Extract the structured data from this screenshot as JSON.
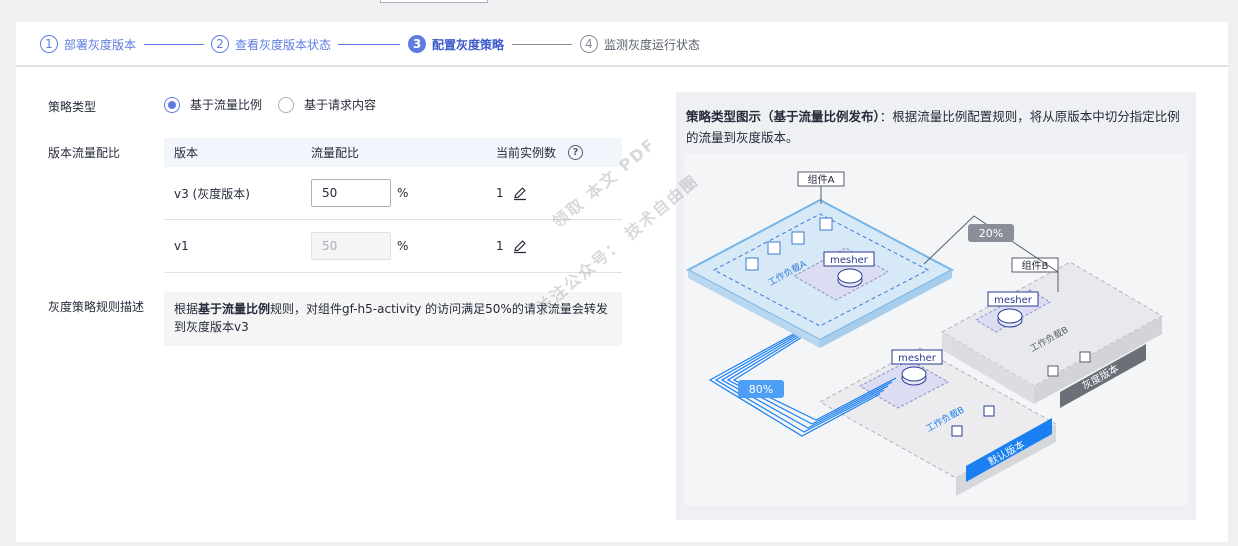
{
  "steps": [
    {
      "num": "1",
      "label": "部署灰度版本"
    },
    {
      "num": "2",
      "label": "查看灰度版本状态"
    },
    {
      "num": "3",
      "label": "配置灰度策略"
    },
    {
      "num": "4",
      "label": "监测灰度运行状态"
    }
  ],
  "form": {
    "strategy_type_label": "策略类型",
    "strategy_options": [
      "基于流量比例",
      "基于请求内容"
    ],
    "selected_strategy": "基于流量比例",
    "traffic_label": "版本流量配比",
    "rule_desc_label": "灰度策略规则描述"
  },
  "table": {
    "headers": [
      "版本",
      "流量配比",
      "当前实例数"
    ],
    "rows": [
      {
        "version": "v3 (灰度版本)",
        "ratio": "50",
        "unit": "%",
        "instances": "1"
      },
      {
        "version": "v1",
        "ratio": "50",
        "unit": "%",
        "instances": "1"
      }
    ]
  },
  "rule_description": {
    "prefix": "根据",
    "bold": "基于流量比例",
    "rest": "规则，对组件gf-h5-activity 的访问满足50%的请求流量会转发到灰度版本v3"
  },
  "diagram": {
    "title_bold": "策略类型图示（基于流量比例发布）",
    "title_rest": "：根据流量比例配置规则，将从原版本中切分指定比例的流量到灰度版本。",
    "component_a": "组件A",
    "component_b": "组件B",
    "pct_20": "20%",
    "pct_80": "80%",
    "mesher": "mesher",
    "workload_a": "工作负载A",
    "workload_b": "工作负载B",
    "workload_b2": "工作负载B",
    "default_version": "默认版本",
    "gray_version": "灰度版本"
  },
  "watermarks": [
    "领取 本文 PDF",
    "关注公众号：  技术自由圈"
  ],
  "colors": {
    "accent": "#5e7ce0",
    "blue_band": "#1a7ff0",
    "gray_band": "#6b6f78"
  }
}
